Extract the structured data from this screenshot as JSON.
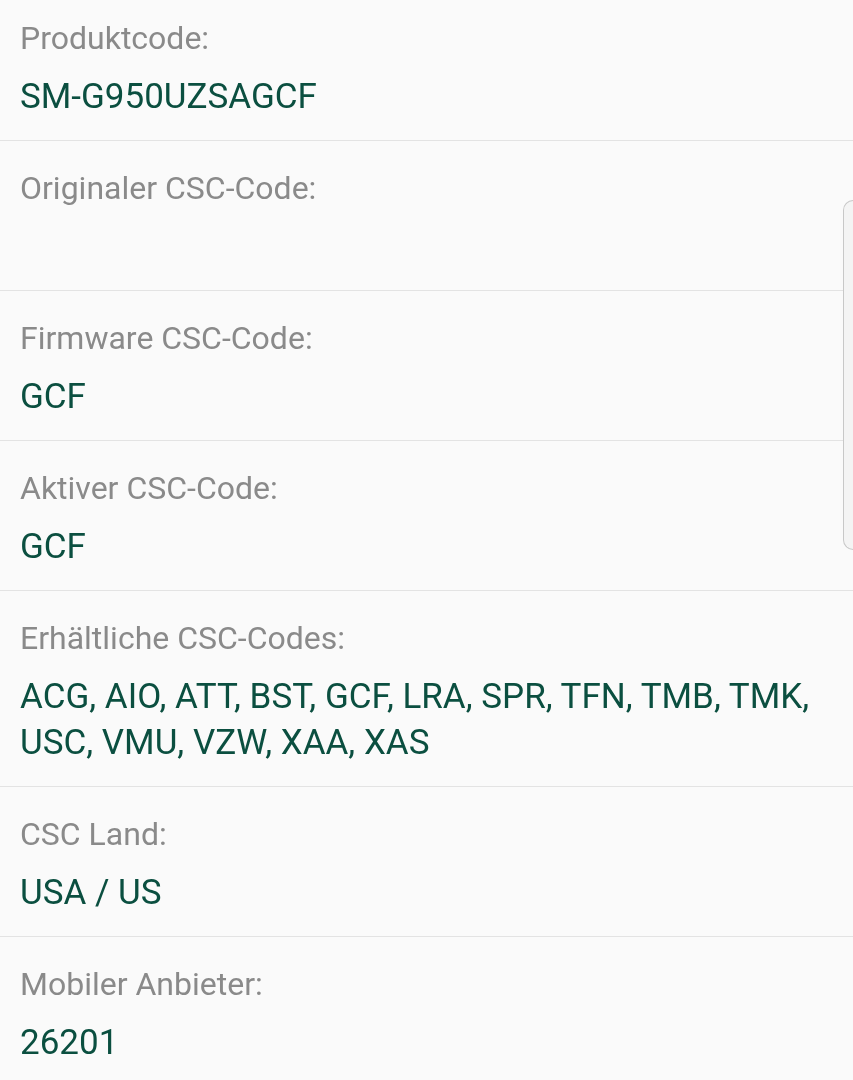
{
  "fields": [
    {
      "label": "Produktcode:",
      "value": "SM-G950UZSAGCF"
    },
    {
      "label": "Originaler CSC-Code:"
    },
    {
      "label": "Firmware CSC-Code:",
      "value": "GCF"
    },
    {
      "label": "Aktiver CSC-Code:",
      "value": "GCF"
    },
    {
      "label": "Erhältliche CSC-Codes:",
      "value": "ACG, AIO, ATT, BST, GCF, LRA, SPR, TFN, TMB, TMK, USC, VMU, VZW, XAA, XAS"
    },
    {
      "label": "CSC Land:",
      "value": "USA / US"
    },
    {
      "label": "Mobiler Anbieter:",
      "value": "26201"
    }
  ]
}
